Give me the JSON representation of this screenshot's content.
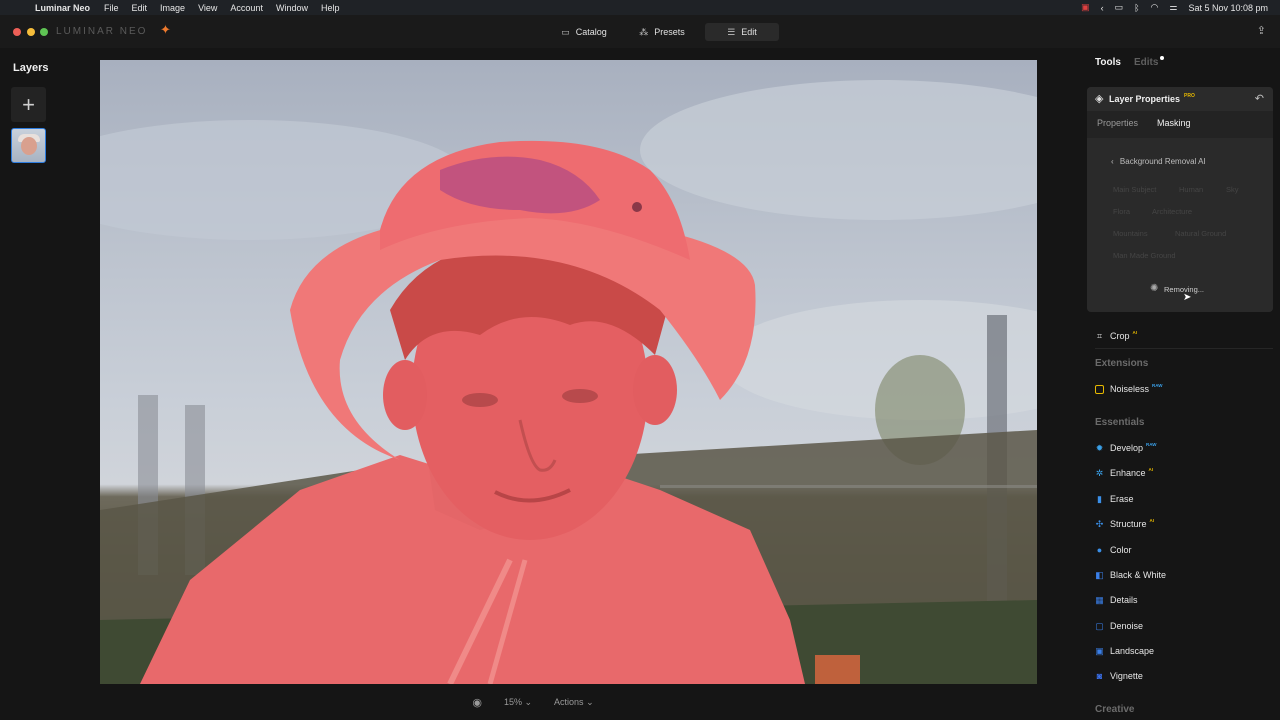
{
  "menubar": {
    "app_name": "Luminar Neo",
    "items": [
      "File",
      "Edit",
      "Image",
      "View",
      "Account",
      "Window",
      "Help"
    ],
    "datetime": "Sat 5 Nov  10:08 pm"
  },
  "titlebar": {
    "logo": "LUMINAR NEO",
    "tabs": [
      {
        "label": "Catalog",
        "icon": "folder-icon"
      },
      {
        "label": "Presets",
        "icon": "sparkle-icon"
      },
      {
        "label": "Edit",
        "icon": "sliders-icon"
      }
    ]
  },
  "layers": {
    "title": "Layers",
    "add_symbol": "+"
  },
  "bottombar": {
    "zoom": "15%",
    "actions": "Actions"
  },
  "panel": {
    "tab_tools": "Tools",
    "tab_edits": "Edits",
    "layer_properties": {
      "title": "Layer Properties",
      "badge": "PRO",
      "subtab_properties": "Properties",
      "subtab_masking": "Masking",
      "back_label": "Background Removal AI",
      "chips": [
        "Main Subject",
        "Human",
        "Sky",
        "Flora",
        "Architecture",
        "Mountains",
        "Natural Ground",
        "Man Made Ground"
      ],
      "status": "Removing..."
    },
    "crop": {
      "label": "Crop",
      "badge": "AI"
    },
    "extensions_title": "Extensions",
    "noiseless": {
      "label": "Noiseless",
      "badge": "RAW"
    },
    "essentials_title": "Essentials",
    "essentials": [
      {
        "label": "Develop",
        "badge": "RAW",
        "icon": "develop-icon",
        "color": "#3aa0e8"
      },
      {
        "label": "Enhance",
        "badge": "AI",
        "icon": "enhance-icon",
        "color": "#3aa0e8"
      },
      {
        "label": "Erase",
        "badge": "",
        "icon": "erase-icon",
        "color": "#3a8fe8"
      },
      {
        "label": "Structure",
        "badge": "AI",
        "icon": "structure-icon",
        "color": "#3a8fe8"
      },
      {
        "label": "Color",
        "badge": "",
        "icon": "color-icon",
        "color": "#3a8fe8"
      },
      {
        "label": "Black & White",
        "badge": "",
        "icon": "bw-icon",
        "color": "#3a7fe8"
      },
      {
        "label": "Details",
        "badge": "",
        "icon": "details-icon",
        "color": "#3a7fe8"
      },
      {
        "label": "Denoise",
        "badge": "",
        "icon": "denoise-icon",
        "color": "#3a7fe8"
      },
      {
        "label": "Landscape",
        "badge": "",
        "icon": "landscape-icon",
        "color": "#3a7fe8"
      },
      {
        "label": "Vignette",
        "badge": "",
        "icon": "vignette-icon",
        "color": "#3a6fe8"
      }
    ],
    "creative_title": "Creative"
  }
}
